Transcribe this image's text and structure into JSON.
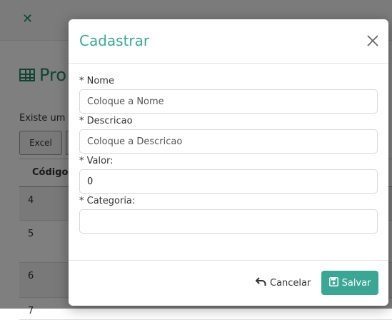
{
  "background": {
    "page_title": "Pro",
    "info_text": "Existe um t",
    "excel_label": "Excel",
    "table": {
      "header_codigo": "Código",
      "rows": [
        "4",
        "5",
        "6",
        "7"
      ]
    }
  },
  "modal": {
    "title": "Cadastrar",
    "fields": [
      {
        "label": "* Nome",
        "placeholder": "Coloque a Nome",
        "value": ""
      },
      {
        "label": "* Descricao",
        "placeholder": "Coloque a Descricao",
        "value": ""
      },
      {
        "label": "* Valor:",
        "placeholder": "",
        "value": "0"
      },
      {
        "label": "* Categoria:",
        "placeholder": "",
        "value": ""
      }
    ],
    "cancel_label": "Cancelar",
    "save_label": "Salvar"
  },
  "colors": {
    "accent": "#3aa795",
    "page_green": "#1f8a67"
  }
}
